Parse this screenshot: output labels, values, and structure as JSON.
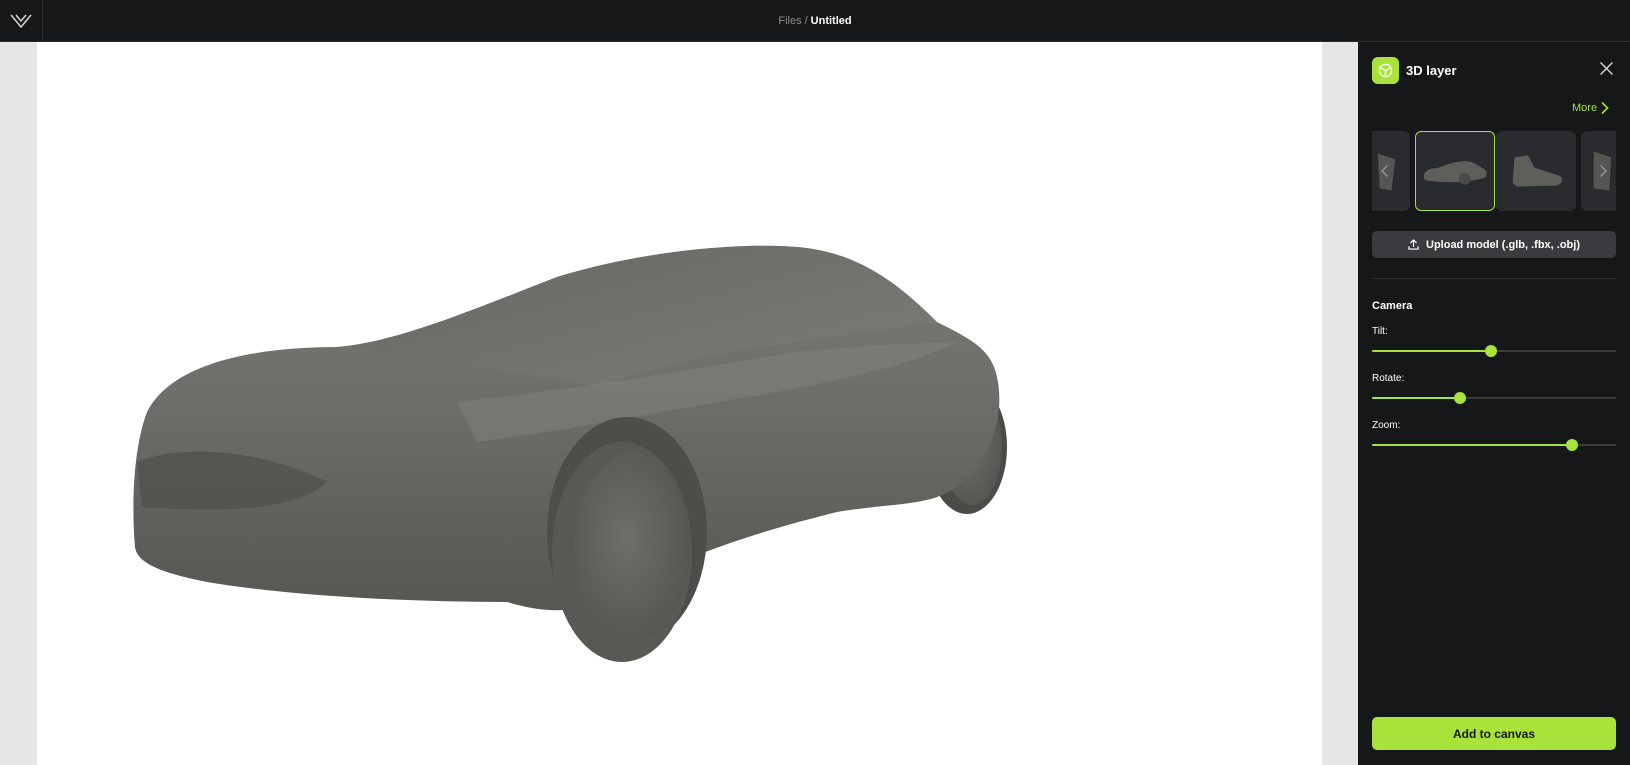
{
  "header": {
    "breadcrumb_root": "Files",
    "breadcrumb_separator": "/",
    "breadcrumb_current": "Untitled",
    "logo_icon": "logo-chevron-icon"
  },
  "canvas": {
    "model": "car",
    "model_color": "#6b6b67",
    "background": "#ffffff"
  },
  "panel": {
    "title": "3D layer",
    "title_icon": "cube-icon",
    "more_label": "More",
    "thumbnails": [
      {
        "name": "partial-model",
        "selected": false
      },
      {
        "name": "car",
        "selected": true
      },
      {
        "name": "sneaker",
        "selected": false
      },
      {
        "name": "partial-model",
        "selected": false
      }
    ],
    "upload_label": "Upload model (.glb, .fbx, .obj)",
    "camera": {
      "heading": "Camera",
      "sliders": [
        {
          "label": "Tilt:",
          "value": 0.487
        },
        {
          "label": "Rotate:",
          "value": 0.36
        },
        {
          "label": "Zoom:",
          "value": 0.82
        }
      ]
    },
    "add_label": "Add to canvas"
  },
  "colors": {
    "accent": "#a8e23b",
    "panel_bg": "#161719",
    "topbar_bg": "#161719"
  }
}
